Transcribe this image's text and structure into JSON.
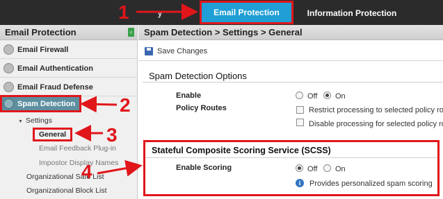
{
  "topbar": {
    "partial_tab_label": "y",
    "tabs": [
      {
        "label": "Email Protection",
        "selected": true
      },
      {
        "label": "Information Protection",
        "selected": false
      }
    ]
  },
  "left_panel": {
    "title": "Email Protection",
    "nav_items": [
      {
        "label": "Email Firewall",
        "icon": "firewall-icon"
      },
      {
        "label": "Email Authentication",
        "icon": "authentication-icon"
      },
      {
        "label": "Email Fraud Defense",
        "icon": "fraud-defense-icon"
      },
      {
        "label": "Spam Detection",
        "icon": "funnel-icon",
        "selected": true
      }
    ],
    "tree": {
      "settings_label": "Settings",
      "general_label": "General",
      "feedback_label": "Email Feedback Plug-in",
      "impostor_label": "Impostor Display Names",
      "safe_list_label": "Organizational Safe List",
      "block_list_label": "Organizational Block List"
    }
  },
  "main": {
    "breadcrumb": "Spam Detection > Settings > General",
    "toolbar": {
      "save_label": "Save Changes"
    },
    "spam_options": {
      "title": "Spam Detection Options",
      "enable_label": "Enable",
      "enable_value": "On",
      "off_label": "Off",
      "on_label": "On",
      "policy_routes_label": "Policy Routes",
      "restrict_label": "Restrict processing to selected policy routes",
      "disable_label": "Disable processing for selected policy routes"
    },
    "scss": {
      "title": "Stateful Composite Scoring Service (SCSS)",
      "enable_scoring_label": "Enable Scoring",
      "enable_scoring_value": "Off",
      "off_label": "Off",
      "on_label": "On",
      "info_text": "Provides personalized spam scoring"
    }
  },
  "annotations": {
    "numbers": [
      "1",
      "2",
      "3",
      "4"
    ],
    "color": "#e0161b"
  },
  "colors": {
    "tab_selected": "#1f9fd5",
    "topbar": "#2b2b2b",
    "nav_selected": "#5d8f9f",
    "highlight": "#e0161b"
  }
}
